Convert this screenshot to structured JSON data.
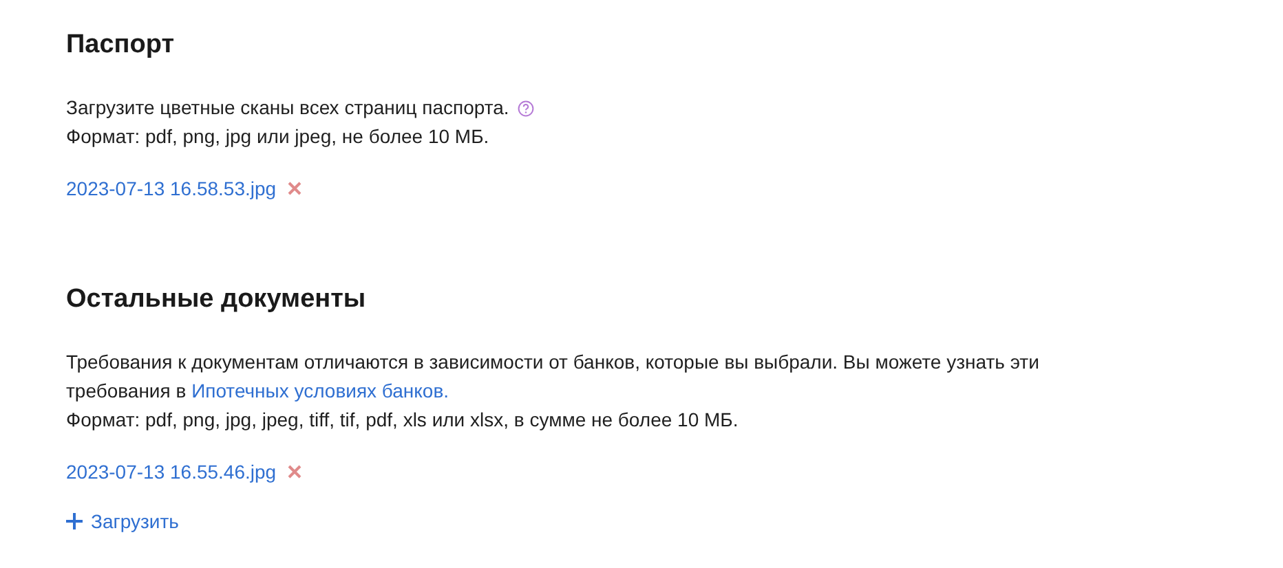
{
  "sections": [
    {
      "title": "Паспорт",
      "description": [
        {
          "kind": "text",
          "text": "Загрузите цветные сканы всех страниц паспорта."
        }
      ],
      "help": true,
      "format": "Формат: pdf, png, jpg или jpeg, не более 10 МБ.",
      "files": [
        {
          "name": "2023-07-13 16.58.53.jpg"
        }
      ]
    },
    {
      "title": "Остальные документы",
      "description": [
        {
          "kind": "text",
          "text": "Требования к документам отличаются в зависимости от банков, которые вы выбрали. Вы можете узнать эти требования в "
        },
        {
          "kind": "link",
          "text": "Ипотечных условиях банков."
        }
      ],
      "help": false,
      "format": "Формат: pdf, png, jpg, jpeg, tiff, tif, pdf, xls или xlsx, в сумме не более 10 МБ.",
      "files": [
        {
          "name": "2023-07-13 16.55.46.jpg"
        }
      ],
      "upload_label": "Загрузить"
    }
  ]
}
